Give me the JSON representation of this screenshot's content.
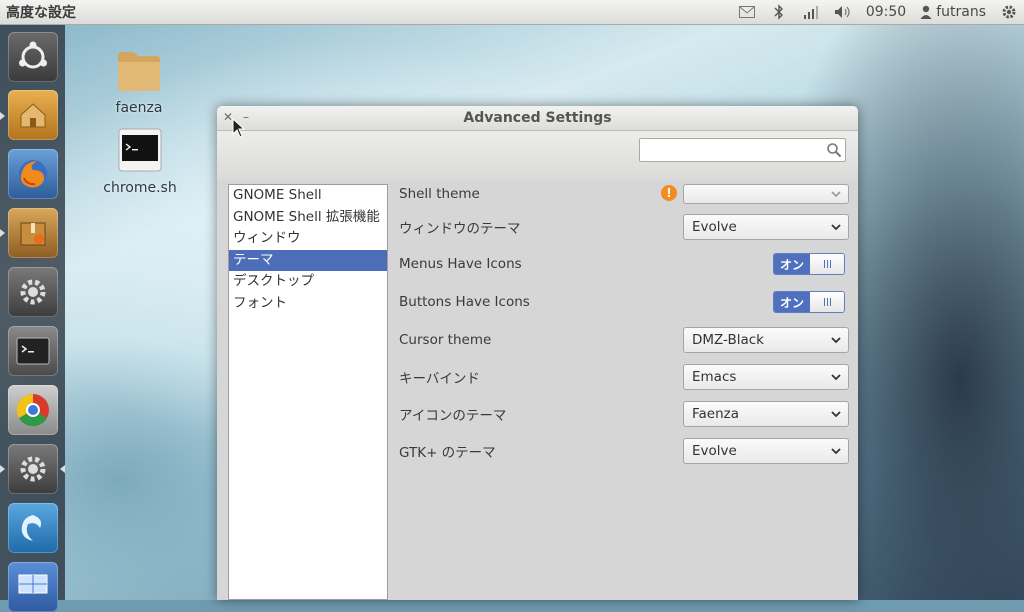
{
  "top_panel": {
    "app_title": "高度な設定",
    "clock": "09:50",
    "user": "futrans",
    "icons": [
      "mail-icon",
      "bluetooth-icon",
      "network-signal-icon",
      "volume-icon",
      "user-icon",
      "gear-icon"
    ]
  },
  "launcher": {
    "items": [
      "dash-home",
      "home-folder",
      "firefox",
      "archive-manager",
      "system-settings",
      "terminal",
      "chrome",
      "system-settings-2",
      "app-blue",
      "workspace-switcher"
    ]
  },
  "desktop_icons": [
    {
      "label": "faenza",
      "icon": "folder-icon"
    },
    {
      "label": "chrome.sh",
      "icon": "terminal-script-icon"
    }
  ],
  "window": {
    "title": "Advanced Settings",
    "search": {
      "value": "",
      "placeholder": ""
    },
    "sidebar": {
      "items": [
        {
          "label": "GNOME Shell"
        },
        {
          "label": "GNOME Shell 拡張機能"
        },
        {
          "label": "ウィンドウ"
        },
        {
          "label": "テーマ"
        },
        {
          "label": "デスクトップ"
        },
        {
          "label": "フォント"
        }
      ],
      "selected_index": 3
    },
    "settings": [
      {
        "label": "Shell theme",
        "type": "combo",
        "value": ""
      },
      {
        "label": "ウィンドウのテーマ",
        "type": "combo",
        "value": "Evolve"
      },
      {
        "label": "Menus Have Icons",
        "type": "switch",
        "value": "オン"
      },
      {
        "label": "Buttons Have Icons",
        "type": "switch",
        "value": "オン"
      },
      {
        "label": "Cursor theme",
        "type": "combo",
        "value": "DMZ-Black"
      },
      {
        "label": "キーバインド",
        "type": "combo",
        "value": "Emacs"
      },
      {
        "label": "アイコンのテーマ",
        "type": "combo",
        "value": "Faenza"
      },
      {
        "label": "GTK+ のテーマ",
        "type": "combo",
        "value": "Evolve"
      }
    ]
  },
  "colors": {
    "selection": "#4c6eb9",
    "switch_on": "#4f71bd",
    "warning": "#f28c1e",
    "launcher_bg": "#28323c"
  }
}
